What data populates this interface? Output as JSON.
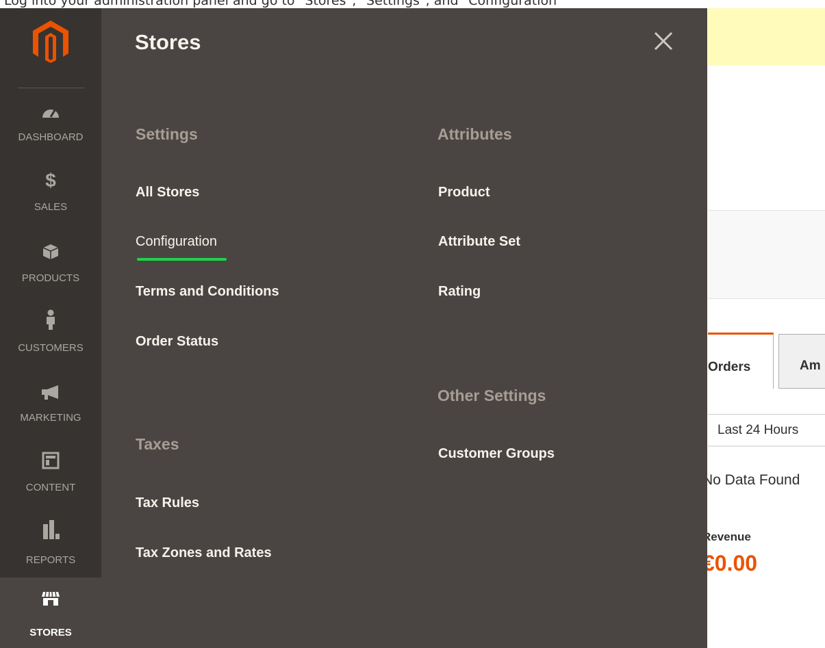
{
  "caption": "Log into your administration panel and go to \"Stores\", \"Settings\", and \"Configuration\"",
  "sidebar": {
    "logo": "magento-logo-icon",
    "items": [
      {
        "label": "DASHBOARD",
        "icon": "dashboard-icon"
      },
      {
        "label": "SALES",
        "icon": "dollar-icon"
      },
      {
        "label": "PRODUCTS",
        "icon": "cube-icon"
      },
      {
        "label": "CUSTOMERS",
        "icon": "person-icon"
      },
      {
        "label": "MARKETING",
        "icon": "megaphone-icon"
      },
      {
        "label": "CONTENT",
        "icon": "layout-icon"
      },
      {
        "label": "REPORTS",
        "icon": "bar-chart-icon"
      },
      {
        "label": "STORES",
        "icon": "storefront-icon",
        "active": true
      }
    ]
  },
  "flyout": {
    "title": "Stores",
    "close_icon": "close-icon",
    "settings": {
      "title": "Settings",
      "items": [
        "All Stores",
        "Configuration",
        "Terms and Conditions",
        "Order Status"
      ]
    },
    "taxes": {
      "title": "Taxes",
      "items": [
        "Tax Rules",
        "Tax Zones and Rates"
      ]
    },
    "attributes": {
      "title": "Attributes",
      "items": [
        "Product",
        "Attribute Set",
        "Rating"
      ]
    },
    "other_settings": {
      "title": "Other Settings",
      "items": [
        "Customer Groups"
      ]
    }
  },
  "background": {
    "tab_active": "Orders",
    "tab_next": "Am",
    "range": "Last 24 Hours",
    "no_data": "No Data Found",
    "revenue_label": "Revenue",
    "revenue_value": "€0.00"
  },
  "colors": {
    "sidebar_bg": "#373330",
    "flyout_bg": "#4a4542",
    "accent_orange": "#eb5202",
    "highlight_green": "#1fd34a",
    "notice_yellow": "#fffbbb"
  }
}
